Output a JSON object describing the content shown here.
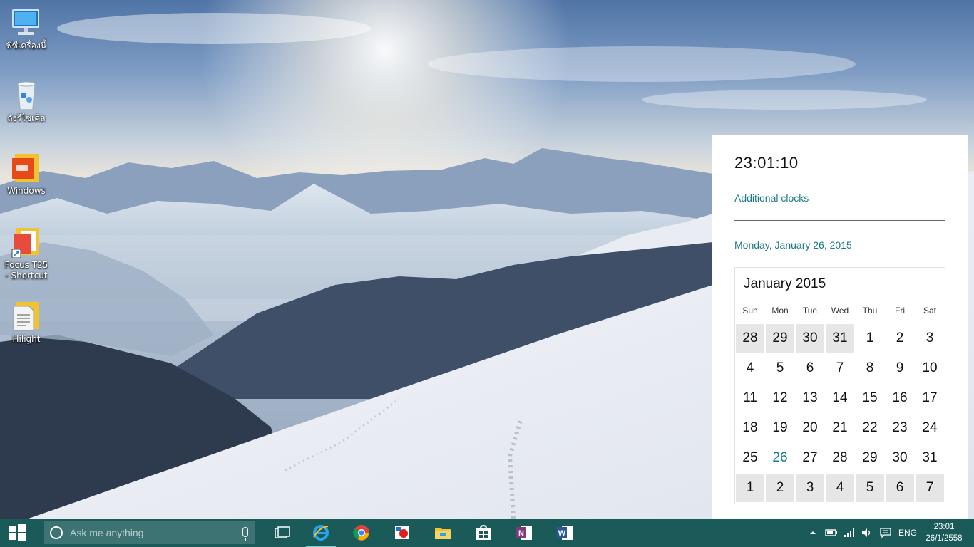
{
  "desktop": {
    "icons": [
      {
        "label": "พีซีเครื่องนี้",
        "icon": "computer-icon"
      },
      {
        "label": "ถังรีไซเคิล",
        "icon": "recycle-bin-icon"
      },
      {
        "label": "Windows",
        "icon": "office-icon"
      },
      {
        "label": "Focus T25 - Shortcut",
        "icon": "folder-shortcut-icon"
      },
      {
        "label": "Hilight",
        "icon": "document-icon"
      }
    ]
  },
  "flyout": {
    "time": "23:01:10",
    "additional_clocks": "Additional clocks",
    "long_date": "Monday, January 26, 2015",
    "calendar": {
      "month_title": "January 2015",
      "weekdays": [
        "Sun",
        "Mon",
        "Tue",
        "Wed",
        "Thu",
        "Fri",
        "Sat"
      ],
      "days": [
        {
          "d": "28",
          "other": true
        },
        {
          "d": "29",
          "other": true
        },
        {
          "d": "30",
          "other": true
        },
        {
          "d": "31",
          "other": true
        },
        {
          "d": "1"
        },
        {
          "d": "2"
        },
        {
          "d": "3"
        },
        {
          "d": "4"
        },
        {
          "d": "5"
        },
        {
          "d": "6"
        },
        {
          "d": "7"
        },
        {
          "d": "8"
        },
        {
          "d": "9"
        },
        {
          "d": "10"
        },
        {
          "d": "11"
        },
        {
          "d": "12"
        },
        {
          "d": "13"
        },
        {
          "d": "14"
        },
        {
          "d": "15"
        },
        {
          "d": "16"
        },
        {
          "d": "17"
        },
        {
          "d": "18"
        },
        {
          "d": "19"
        },
        {
          "d": "20"
        },
        {
          "d": "21"
        },
        {
          "d": "22"
        },
        {
          "d": "23"
        },
        {
          "d": "24"
        },
        {
          "d": "25"
        },
        {
          "d": "26",
          "today": true
        },
        {
          "d": "27"
        },
        {
          "d": "28"
        },
        {
          "d": "29"
        },
        {
          "d": "30"
        },
        {
          "d": "31"
        },
        {
          "d": "1",
          "other": true
        },
        {
          "d": "2",
          "other": true
        },
        {
          "d": "3",
          "other": true
        },
        {
          "d": "4",
          "other": true
        },
        {
          "d": "5",
          "other": true
        },
        {
          "d": "6",
          "other": true
        },
        {
          "d": "7",
          "other": true
        }
      ]
    }
  },
  "taskbar": {
    "search_placeholder": "Ask me anything",
    "apps": [
      {
        "name": "task-view",
        "icon": "task-view-icon"
      },
      {
        "name": "internet-explorer",
        "icon": "internet-explorer-icon",
        "active": true
      },
      {
        "name": "chrome",
        "icon": "chrome-icon"
      },
      {
        "name": "photos-app",
        "icon": "photos-icon"
      },
      {
        "name": "file-explorer",
        "icon": "folder-icon"
      },
      {
        "name": "store",
        "icon": "store-icon"
      },
      {
        "name": "onenote",
        "icon": "onenote-icon"
      },
      {
        "name": "word",
        "icon": "word-icon"
      }
    ],
    "tray": {
      "language": "ENG",
      "time": "23:01",
      "date": "26/1/2558"
    }
  },
  "colors": {
    "taskbar": "#1a5a59",
    "accent": "#1b7a86"
  }
}
